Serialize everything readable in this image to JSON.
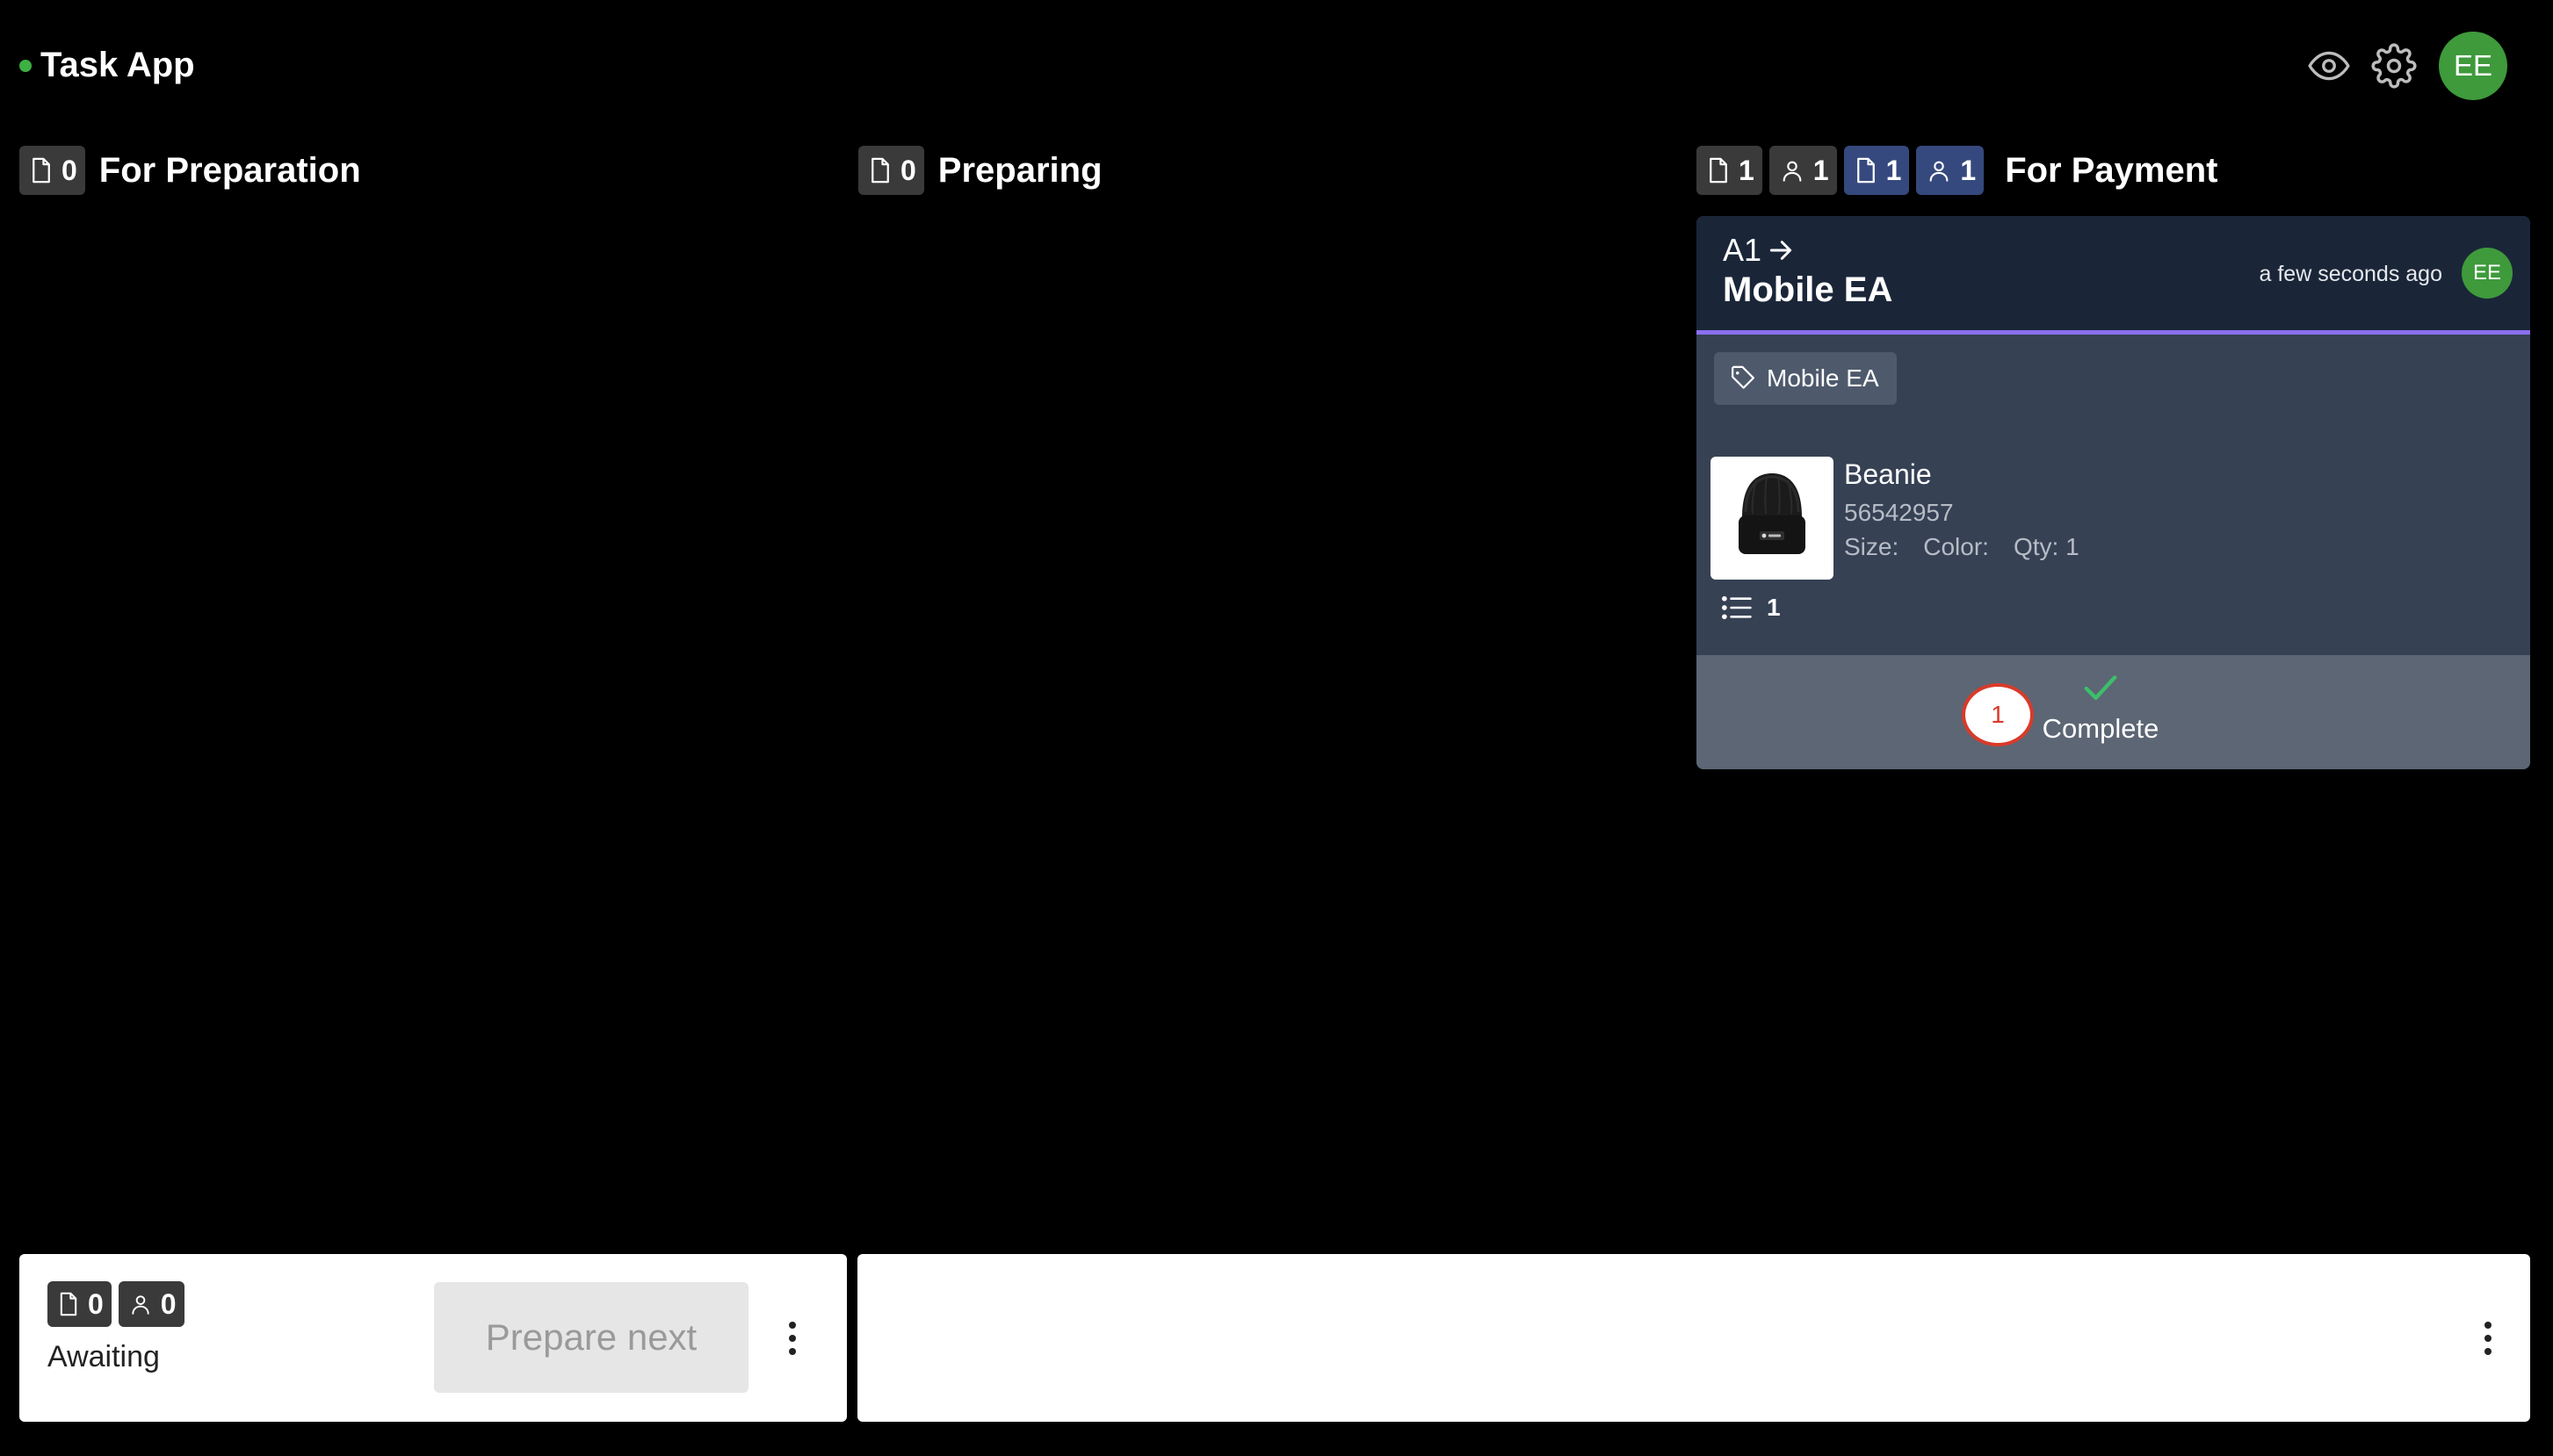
{
  "app": {
    "title": "Task App",
    "status_color": "#3cb043",
    "user_initials": "EE"
  },
  "header_icons": [
    "eye-icon",
    "gear-icon"
  ],
  "columns": [
    {
      "title": "For Preparation",
      "badges": [
        {
          "icon": "document-icon",
          "count": "0"
        }
      ]
    },
    {
      "title": "Preparing",
      "badges": [
        {
          "icon": "document-icon",
          "count": "0"
        }
      ]
    },
    {
      "title": "For Payment",
      "badges": [
        {
          "icon": "document-icon",
          "count": "1",
          "style": "dark"
        },
        {
          "icon": "person-icon",
          "count": "1",
          "style": "dark"
        },
        {
          "icon": "document-icon",
          "count": "1",
          "style": "blue"
        },
        {
          "icon": "person-icon",
          "count": "1",
          "style": "blue"
        }
      ]
    }
  ],
  "card": {
    "code": "A1",
    "name": "Mobile EA",
    "time": "a few seconds ago",
    "user_initials": "EE",
    "accent_color": "#8a6ff0",
    "tag": "Mobile EA",
    "product": {
      "name": "Beanie",
      "sku": "56542957",
      "size_label": "Size:",
      "color_label": "Color:",
      "qty_label": "Qty: 1"
    },
    "lines_count": "1",
    "step": "1",
    "complete_label": "Complete"
  },
  "awaiting_panel": {
    "orders_count": "0",
    "people_count": "0",
    "label": "Awaiting",
    "prepare_label": "Prepare next"
  }
}
